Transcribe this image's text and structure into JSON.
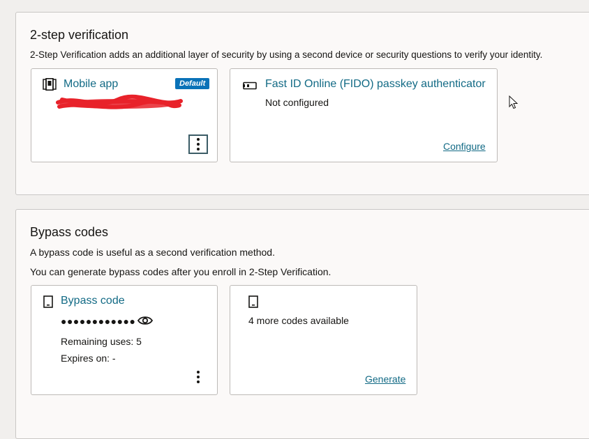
{
  "two_step": {
    "title": "2-step verification",
    "description": "2-Step Verification adds an additional layer of security by using a second device or security questions to verify your identity.",
    "mobile_card": {
      "icon": "mobile-app-icon",
      "title": "Mobile app",
      "badge": "Default"
    },
    "fido_card": {
      "icon": "security-key-icon",
      "title": "Fast ID Online (FIDO) passkey authenticator",
      "status": "Not configured",
      "action": "Configure"
    }
  },
  "bypass": {
    "title": "Bypass codes",
    "description_1": "A bypass code is useful as a second verification method.",
    "description_2": "You can generate bypass codes after you enroll in 2-Step Verification.",
    "code_card": {
      "icon": "device-icon",
      "title": "Bypass code",
      "masked_code": "●●●●●●●●●●●●",
      "remaining": "Remaining uses: 5",
      "expires": "Expires on: -"
    },
    "generate_card": {
      "icon": "device-icon",
      "available": "4 more codes available",
      "action": "Generate"
    }
  },
  "colors": {
    "link": "#126a85",
    "badge": "#0a72b8",
    "redaction": "#e8222a"
  }
}
